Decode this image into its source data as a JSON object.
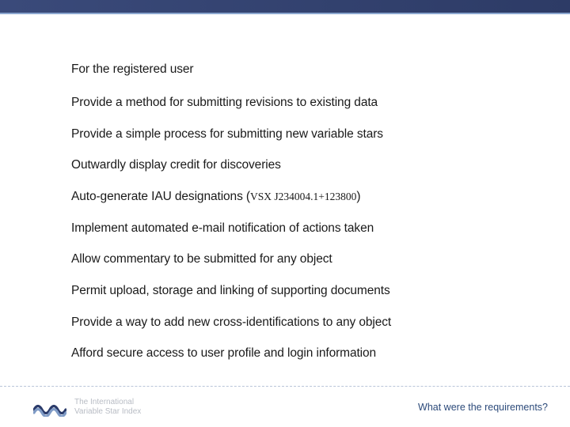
{
  "lines": [
    "For the registered user",
    "Provide a method for submitting revisions to existing data",
    "Provide a simple process for submitting new variable stars",
    "Outwardly display credit for discoveries",
    {
      "prefix": "Auto-generate IAU designations (",
      "small": "VSX J234004.1+123800",
      "suffix": ")"
    },
    "Implement automated e-mail notification of actions taken",
    "Allow commentary to be submitted for any object",
    "Permit upload, storage and linking of supporting documents",
    "Provide a way to add new cross-identifications to any object",
    "Afford secure access to user profile and login information"
  ],
  "brand": {
    "line1": "The International",
    "line2": "Variable Star Index"
  },
  "footer_caption": "What were the requirements?",
  "colors": {
    "wave_dark": "#2a3a6a",
    "wave_light": "#7f9bc6"
  }
}
